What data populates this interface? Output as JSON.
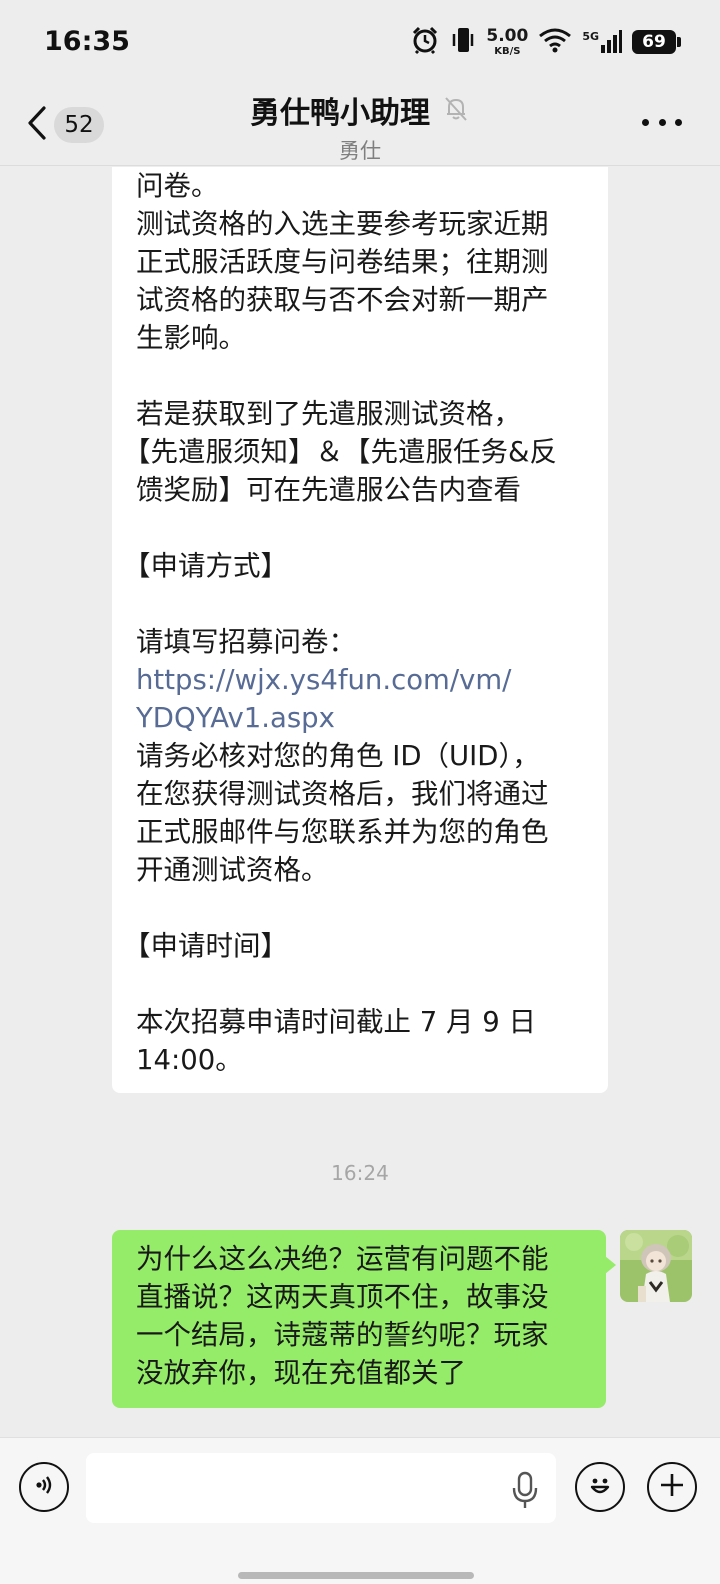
{
  "status_bar": {
    "time": "16:35",
    "net_speed_value": "5.00",
    "net_speed_unit": "KB/S",
    "network": "5G",
    "battery": "69",
    "icons": [
      "alarm-icon",
      "vibrate-icon",
      "wifi-icon",
      "signal-icon",
      "battery-icon"
    ]
  },
  "header": {
    "back_badge": "52",
    "title": "勇仕鸭小助理",
    "subtitle": "勇仕",
    "icons": [
      "back-chevron-icon",
      "mute-bell-icon",
      "more-dots-icon"
    ]
  },
  "chat": {
    "incoming_lines": [
      "问卷。",
      "测试资格的入选主要参考玩家近期",
      "正式服活跃度与问卷结果；往期测",
      "试资格的获取与否不会对新一期产",
      "生影响。",
      "",
      "若是获取到了先遣服测试资格，",
      "【先遣服须知】＆【先遣服任务&反",
      "馈奖励】可在先遣服公告内查看",
      "",
      "【申请方式】",
      "",
      "请填写招募问卷：",
      "https://wjx.ys4fun.com/vm/",
      "YDQYAv1.aspx",
      "请务必核对您的角色 ID（UID），",
      "在您获得测试资格后，我们将通过",
      "正式服邮件与您联系并为您的角色",
      "开通测试资格。",
      "",
      "【申请时间】",
      "",
      "本次招募申请时间截止 7 月 9 日",
      "14:00。"
    ],
    "timestamp": "16:24",
    "outgoing_lines": [
      "为什么这么决绝？运营有问题不能",
      "直播说？这两天真顶不住，故事没",
      "一个结局，诗蔻蒂的誓约呢？玩家",
      "没放弃你，现在充值都关了"
    ]
  },
  "input_bar": {
    "placeholder": "",
    "icons": [
      "voice-toggle-icon",
      "microphone-icon",
      "emoji-icon",
      "plus-icon"
    ]
  },
  "colors": {
    "background": "#ededed",
    "incoming_bubble": "#ffffff",
    "outgoing_bubble": "#95ec69",
    "link": "#576b95"
  }
}
